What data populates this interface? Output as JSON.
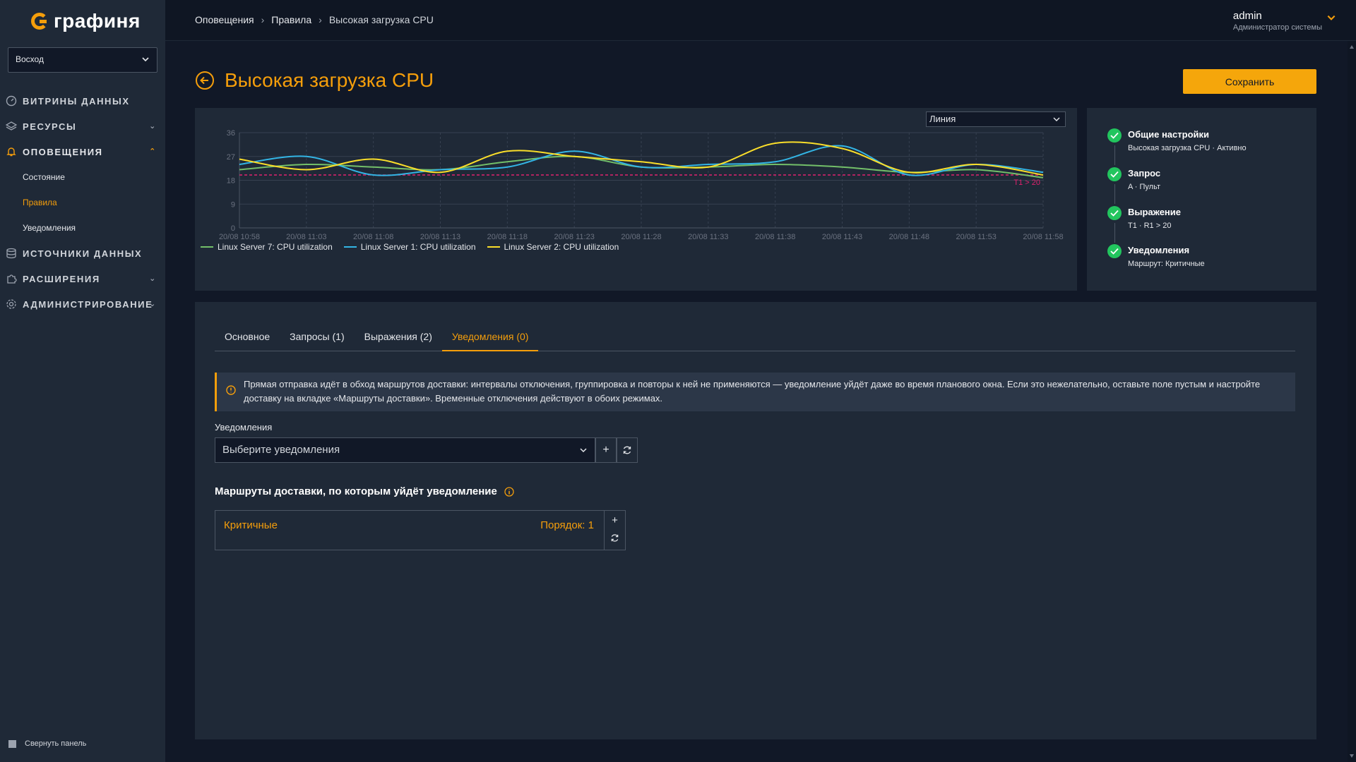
{
  "app": {
    "logo_text": "графиня"
  },
  "sidebar": {
    "org": "Восход",
    "items": [
      {
        "label": "ВИТРИНЫ ДАННЫХ",
        "icon": "dashboard-icon",
        "has_arrow": false
      },
      {
        "label": "РЕСУРСЫ",
        "icon": "layers-icon",
        "has_arrow": true
      },
      {
        "label": "ОПОВЕЩЕНИЯ",
        "icon": "bell-icon",
        "has_arrow": true,
        "expanded": true
      },
      {
        "label": "ИСТОЧНИКИ ДАННЫХ",
        "icon": "database-icon",
        "has_arrow": false
      },
      {
        "label": "РАСШИРЕНИЯ",
        "icon": "puzzle-icon",
        "has_arrow": true
      },
      {
        "label": "АДМИНИСТРИРОВАНИЕ",
        "icon": "gear-icon",
        "has_arrow": true
      }
    ],
    "sub_items": [
      {
        "label": "Состояние"
      },
      {
        "label": "Правила",
        "current": true
      },
      {
        "label": "Уведомления"
      }
    ],
    "collapse_label": "Свернуть панель"
  },
  "topbar": {
    "breadcrumbs": [
      "Оповещения",
      "Правила",
      "Высокая загрузка CPU"
    ],
    "user_name": "admin",
    "user_role": "Администратор системы"
  },
  "page": {
    "title": "Высокая загрузка CPU",
    "save_label": "Сохранить"
  },
  "chart": {
    "viz_type": "Линия",
    "threshold_label": "T1 > 20"
  },
  "chart_data": {
    "type": "line",
    "x": [
      "20/08 10:58",
      "20/08 11:03",
      "20/08 11:08",
      "20/08 11:13",
      "20/08 11:18",
      "20/08 11:23",
      "20/08 11:28",
      "20/08 11:33",
      "20/08 11:38",
      "20/08 11:43",
      "20/08 11:48",
      "20/08 11:53",
      "20/08 11:58"
    ],
    "yticks": [
      0,
      9,
      18,
      27,
      36
    ],
    "ylim": [
      0,
      36
    ],
    "threshold": 20,
    "series": [
      {
        "name": "Linux Server 7: CPU utilization",
        "color": "#73bf69",
        "values": [
          22,
          24,
          23,
          22,
          25,
          27,
          23,
          23,
          24,
          23,
          21,
          22,
          19
        ]
      },
      {
        "name": "Linux Server 1: CPU utilization",
        "color": "#33b5e5",
        "values": [
          24,
          27,
          20,
          22,
          23,
          29,
          23,
          24,
          25,
          31,
          20,
          24,
          21
        ]
      },
      {
        "name": "Linux Server 2: CPU utilization",
        "color": "#fade2a",
        "values": [
          26,
          22,
          26,
          21,
          29,
          27,
          25,
          23,
          32,
          30,
          21,
          24,
          20
        ]
      }
    ]
  },
  "steps": [
    {
      "title": "Общие настройки",
      "sub": "Высокая загрузка CPU · Активно"
    },
    {
      "title": "Запрос",
      "sub": "A · Пульт"
    },
    {
      "title": "Выражение",
      "sub": "T1 · R1 > 20"
    },
    {
      "title": "Уведомления",
      "sub": "Маршрут: Критичные"
    }
  ],
  "tabs": [
    {
      "label": "Основное"
    },
    {
      "label": "Запросы (1)"
    },
    {
      "label": "Выражения (2)"
    },
    {
      "label": "Уведомления (0)",
      "active": true
    }
  ],
  "alert": {
    "text": "Прямая отправка идёт в обход маршрутов доставки: интервалы отключения, группировка и повторы к ней не применяются — уведомление уйдёт даже во время планового окна. Если это нежелательно, оставьте поле пустым и настройте доставку на вкладке «Маршруты доставки». Временные отключения действуют в обоих режимах."
  },
  "notifications": {
    "label": "Уведомления",
    "placeholder": "Выберите уведомления"
  },
  "routes": {
    "title": "Маршруты доставки, по которым уйдёт уведомление",
    "items": [
      {
        "name": "Критичные",
        "order": "Порядок: 1"
      }
    ]
  },
  "colors": {
    "accent": "#f59e0b",
    "threshold": "#e0226e",
    "success": "#22c55e"
  }
}
